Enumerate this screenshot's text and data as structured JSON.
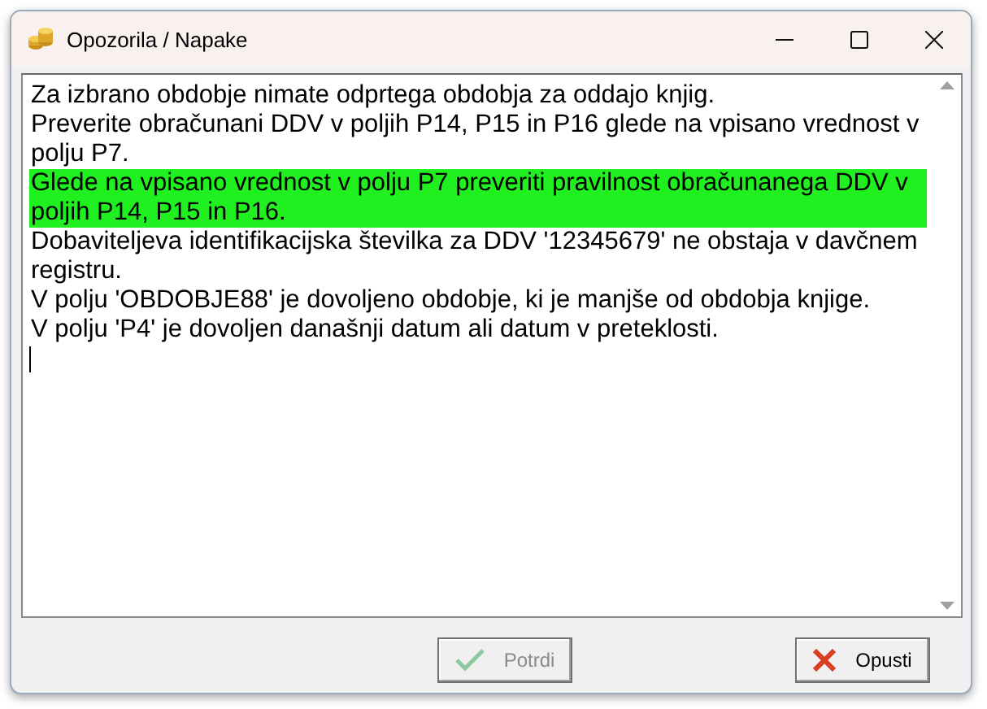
{
  "window": {
    "title": "Opozorila / Napake"
  },
  "messages": [
    {
      "text": "Za izbrano obdobje nimate odprtega obdobja za oddajo knjig.",
      "selected": false
    },
    {
      "text": "Preverite obračunani DDV v poljih P14, P15 in P16 glede na vpisano vrednost v polju P7.",
      "selected": false
    },
    {
      "text": "Glede na vpisano vrednost v polju P7 preveriti pravilnost obračunanega DDV v poljih P14, P15 in P16.",
      "selected": true
    },
    {
      "text": "Dobaviteljeva identifikacijska številka za DDV '12345679' ne obstaja v davčnem registru.",
      "selected": false
    },
    {
      "text": "V polju 'OBDOBJE88' je dovoljeno obdobje, ki je manjše od obdobja knjige.",
      "selected": false
    },
    {
      "text": "V polju 'P4' je dovoljen današnji datum ali datum v preteklosti.",
      "selected": false
    }
  ],
  "buttons": [
    {
      "kind": "confirm",
      "label": "Potrdi",
      "disabled": true
    },
    {
      "kind": "cancel",
      "label": "Opusti",
      "disabled": false
    }
  ]
}
